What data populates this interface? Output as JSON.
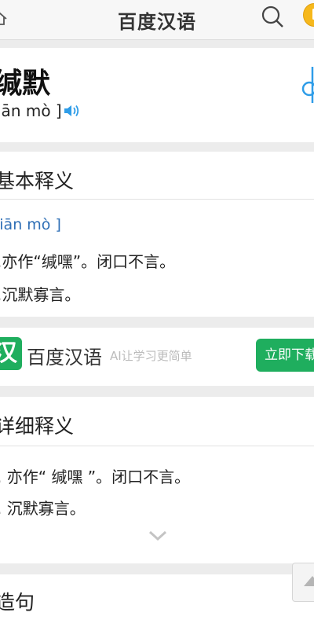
{
  "header": {
    "title": "百度汉语"
  },
  "word": {
    "title": "缄默",
    "pinyin": "[ jiān mò ]",
    "pinyin_visible": "iān mò ]"
  },
  "basic": {
    "heading_visible": "基本释义",
    "pinyin_visible": "jiān mò ]",
    "definitions_visible": [
      ".亦作“缄嘿”。闭口不言。",
      ".沉默寡言。"
    ]
  },
  "banner": {
    "logo_char": "汉",
    "name": "百度汉语",
    "slogan": "AI让学习更简单",
    "button_visible": "立即下载"
  },
  "detailed": {
    "heading_visible": "详细释义",
    "definitions_visible": [
      ". 亦作“ 缄嘿 ”。闭口不言。",
      ". 沉默寡言。"
    ]
  },
  "sentence": {
    "heading_visible": "造句"
  },
  "icons": [
    "home-icon",
    "search-icon",
    "speaker-icon",
    "chevron-down-icon",
    "arrow-up-icon"
  ],
  "colors": {
    "accent_green": "#1fae5e",
    "link_blue": "#2f6fb6",
    "speaker_blue": "#2f9de8"
  }
}
